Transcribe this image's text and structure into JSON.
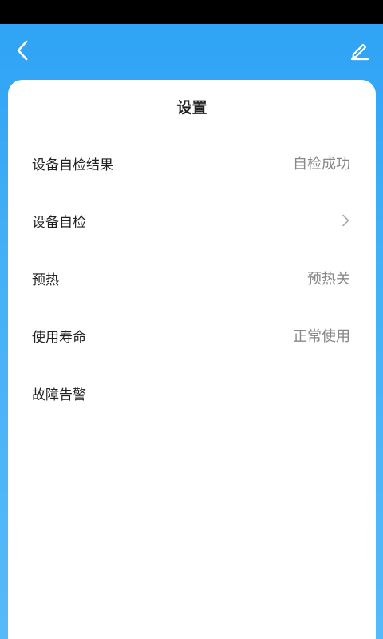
{
  "header": {
    "back_icon": "chevron-left-icon",
    "edit_icon": "edit-pencil-icon"
  },
  "card": {
    "title": "设置",
    "rows": [
      {
        "label": "设备自检结果",
        "value": "自检成功"
      },
      {
        "label": "设备自检",
        "value": "",
        "icon": "chevron-right-icon"
      },
      {
        "label": "预热",
        "value": "预热关"
      },
      {
        "label": "使用寿命",
        "value": "正常使用"
      },
      {
        "label": "故障告警",
        "value": ""
      }
    ]
  },
  "colors": {
    "accent": "#2fa3f5",
    "card_bg": "#ffffff",
    "label_text": "#222222",
    "value_text": "#888888"
  }
}
